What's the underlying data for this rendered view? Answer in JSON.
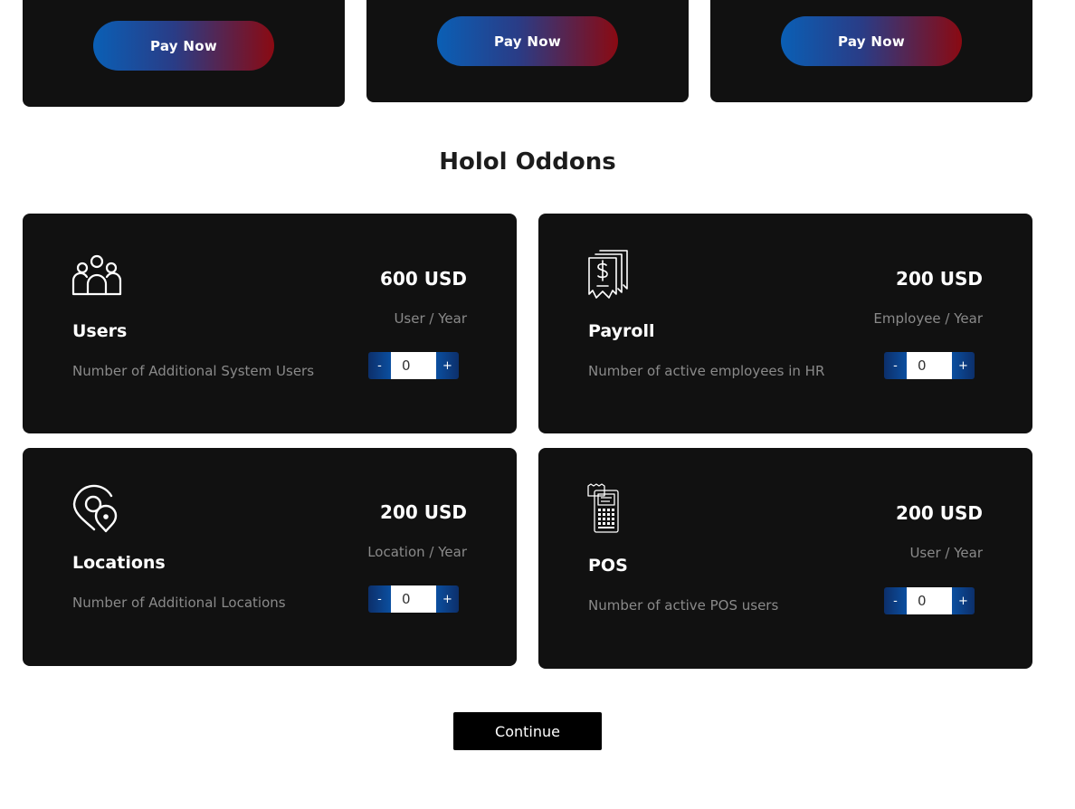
{
  "plans": [
    {
      "button_label": "Pay Now"
    },
    {
      "button_label": "Pay Now"
    },
    {
      "button_label": "Pay Now"
    }
  ],
  "section_title": "Holol Oddons",
  "addons": [
    {
      "name": "Users",
      "icon": "users-group-icon",
      "price": "600 USD",
      "unit": "User / Year",
      "description": "Number of Additional System Users",
      "quantity": "0",
      "minus": "-",
      "plus": "+"
    },
    {
      "name": "Payroll",
      "icon": "receipt-dollar-icon",
      "price": "200 USD",
      "unit": "Employee / Year",
      "description": "Number of active employees in HR",
      "quantity": "0",
      "minus": "-",
      "plus": "+"
    },
    {
      "name": "Locations",
      "icon": "location-pin-icon",
      "price": "200 USD",
      "unit": "Location / Year",
      "description": "Number of Additional Locations",
      "quantity": "0",
      "minus": "-",
      "plus": "+"
    },
    {
      "name": "POS",
      "icon": "pos-terminal-icon",
      "price": "200 USD",
      "unit": "User / Year",
      "description": "Number of active POS users",
      "quantity": "0",
      "minus": "-",
      "plus": "+"
    }
  ],
  "continue_label": "Continue",
  "colors": {
    "card_bg": "#111111",
    "gradient_blue": "#0a5fb5",
    "gradient_red": "#8a0a12",
    "muted_text": "#8a8a8a"
  }
}
